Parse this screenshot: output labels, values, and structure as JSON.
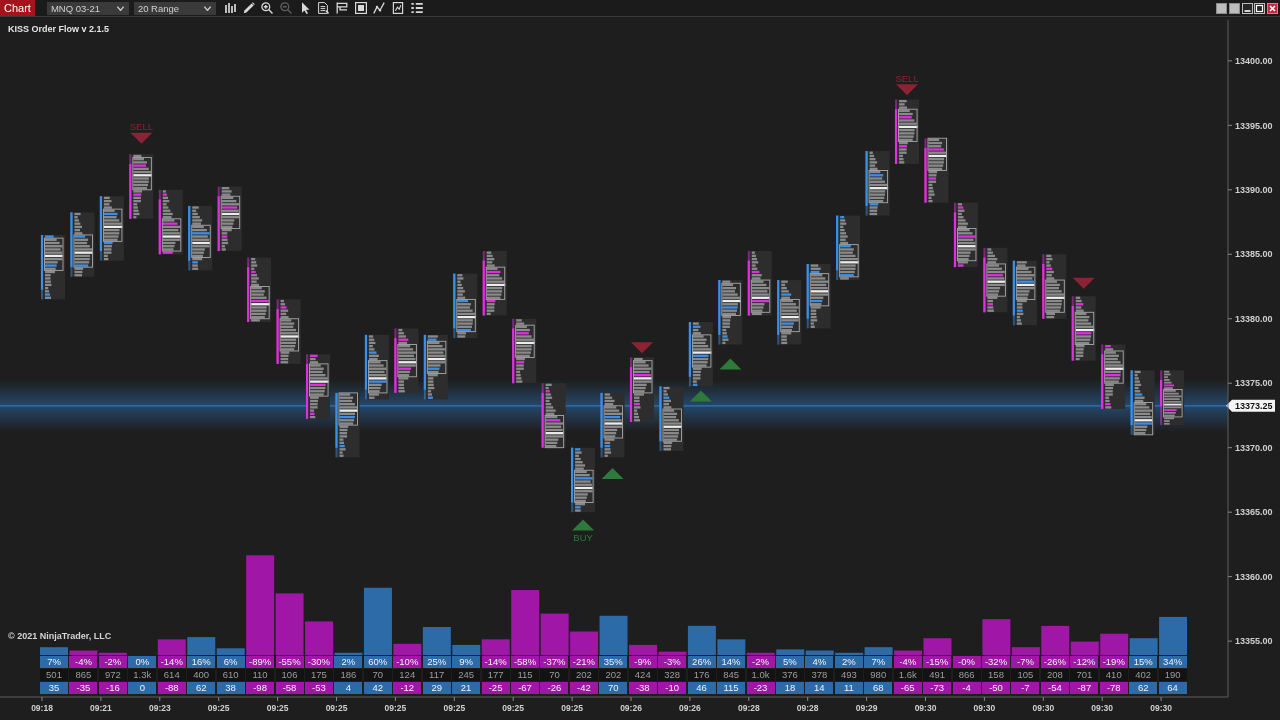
{
  "toolbar": {
    "tab": "Chart",
    "instrument": "MNQ 03-21",
    "interval": "20 Range",
    "tools": [
      {
        "kind": "bars",
        "disabled": false
      },
      {
        "kind": "pencil",
        "disabled": false
      },
      {
        "kind": "zoom_in",
        "disabled": false
      },
      {
        "kind": "zoom_out",
        "disabled": true
      },
      {
        "kind": "pointer",
        "disabled": false
      },
      {
        "kind": "properties",
        "disabled": false
      },
      {
        "kind": "template",
        "disabled": false
      },
      {
        "kind": "snapshot",
        "disabled": false
      },
      {
        "kind": "indicator",
        "disabled": false
      },
      {
        "kind": "strategy",
        "disabled": false
      },
      {
        "kind": "data_box",
        "disabled": false
      }
    ]
  },
  "window_buttons": [
    {
      "kind": "link"
    },
    {
      "kind": "link"
    },
    {
      "kind": "minimize"
    },
    {
      "kind": "maximize"
    },
    {
      "kind": "close"
    }
  ],
  "chart": {
    "indicator_title": "KISS Order Flow v 2.1.5",
    "chart_data": [
      {
        "type": "candlestick",
        "categories": [
          "09:18",
          null,
          "09:21",
          null,
          "09:23",
          null,
          "09:25",
          null,
          "09:25",
          null,
          "09:25",
          null,
          "09:25",
          null,
          "09:25",
          null,
          "09:25",
          null,
          "09:25",
          null,
          "09:26",
          null,
          "09:26",
          null,
          "09:28",
          null,
          "09:28",
          null,
          "09:29",
          null,
          "09:30",
          null,
          "09:30",
          null,
          "09:30",
          null,
          "09:30",
          null,
          "09:30"
        ],
        "ylim": [
          13350.9,
          13403.4
        ],
        "yticks": [
          {
            "value": 13400,
            "label": "13400.00"
          },
          {
            "value": 13395,
            "label": "13395.00"
          },
          {
            "value": 13390,
            "label": "13390.00"
          },
          {
            "value": 13385,
            "label": "13385.00"
          },
          {
            "value": 13380,
            "label": "13380.00"
          },
          {
            "value": 13375,
            "label": "13375.00"
          },
          {
            "value": 13370,
            "label": "13370.00"
          },
          {
            "value": 13365,
            "label": "13365.00"
          },
          {
            "value": 13360,
            "label": "13360.00"
          },
          {
            "value": 13355,
            "label": "13355.00"
          }
        ],
        "ref_lines": [
          {
            "axis": "y",
            "value": 13373.25,
            "label": "13373.25",
            "color": "#2f7fd0"
          }
        ],
        "series": [
          {
            "type": "candlestick",
            "colors": [
              "#3b8fe8",
              "#3b8fe8",
              "#3b8fe8",
              "#e02fe0",
              "#e02fe0",
              "#3b8fe8",
              "#e02fe0",
              "#e02fe0",
              "#e02fe0",
              "#e02fe0",
              "#3b8fe8",
              "#3b8fe8",
              "#e02fe0",
              "#3b8fe8",
              "#3b8fe8",
              "#e02fe0",
              "#e02fe0",
              "#e02fe0",
              "#3b8fe8",
              "#3b8fe8",
              "#e02fe0",
              "#3b8fe8",
              "#3b8fe8",
              "#3b8fe8",
              "#e02fe0",
              "#3b8fe8",
              "#3b8fe8",
              "#3b8fe8",
              "#3b8fe8",
              "#e02fe0",
              "#e02fe0",
              "#e02fe0",
              "#e02fe0",
              "#3b8fe8",
              "#e02fe0",
              "#e02fe0",
              "#e02fe0",
              "#3b8fe8",
              "#e02fe0"
            ],
            "ohlc": [
              [
                13382.25,
                13386.5,
                13381.5,
                13386.5
              ],
              [
                13384,
                13388.25,
                13383.25,
                13388.25
              ],
              [
                13385.25,
                13389.5,
                13384.5,
                13389.5
              ],
              [
                13392,
                13392.75,
                13387.75,
                13387.75
              ],
              [
                13389.25,
                13390,
                13385,
                13385
              ],
              [
                13384.5,
                13388.75,
                13383.75,
                13388.75
              ],
              [
                13389.5,
                13390.25,
                13385.25,
                13385.25
              ],
              [
                13384,
                13384.75,
                13379.75,
                13379.75
              ],
              [
                13380.75,
                13381.5,
                13376.5,
                13376.5
              ],
              [
                13376.5,
                13377.25,
                13372.25,
                13372.25
              ],
              [
                13370,
                13374.25,
                13369.25,
                13374.25
              ],
              [
                13374.5,
                13378.75,
                13373.75,
                13378.75
              ],
              [
                13378.5,
                13379.25,
                13374.25,
                13374.25
              ],
              [
                13374.5,
                13378.75,
                13373.75,
                13378.75
              ],
              [
                13379.25,
                13383.5,
                13378.5,
                13383.5
              ],
              [
                13384.5,
                13385.25,
                13380.25,
                13380.25
              ],
              [
                13379.25,
                13380,
                13375,
                13375
              ],
              [
                13374.25,
                13375,
                13370,
                13370
              ],
              [
                13365.75,
                13370,
                13365,
                13370
              ],
              [
                13370,
                13374.25,
                13369.25,
                13374.25
              ],
              [
                13376.25,
                13377,
                13372,
                13372
              ],
              [
                13370.5,
                13374.75,
                13369.75,
                13374.75
              ],
              [
                13375.5,
                13379.75,
                13374.75,
                13379.75
              ],
              [
                13378.75,
                13383,
                13378,
                13383
              ],
              [
                13384.5,
                13385.25,
                13380.25,
                13380.25
              ],
              [
                13378.75,
                13383,
                13378,
                13383
              ],
              [
                13380,
                13384.25,
                13379.25,
                13384.25
              ],
              [
                13383.75,
                13388,
                13383,
                13388
              ],
              [
                13388.75,
                13393,
                13388,
                13393
              ],
              [
                13396.25,
                13397,
                13392,
                13392
              ],
              [
                13393.25,
                13394,
                13389,
                13389
              ],
              [
                13388.25,
                13389,
                13384,
                13384
              ],
              [
                13384.75,
                13385.5,
                13380.5,
                13380.5
              ],
              [
                13380.25,
                13384.5,
                13379.5,
                13384.5
              ],
              [
                13384.25,
                13385,
                13380,
                13380
              ],
              [
                13381,
                13381.75,
                13376.75,
                13376.75
              ],
              [
                13377.25,
                13378,
                13373,
                13373
              ],
              [
                13371.75,
                13376,
                13371,
                13376
              ],
              [
                13375.25,
                13376,
                13371.75,
                13373.25
              ]
            ]
          },
          {
            "type": "scatter",
            "marker": "triangle-down",
            "color": "#8a2434",
            "values": [
              null,
              null,
              null,
              13394,
              null,
              null,
              null,
              null,
              null,
              null,
              null,
              null,
              null,
              null,
              null,
              null,
              null,
              null,
              null,
              null,
              13377.75,
              null,
              null,
              null,
              null,
              null,
              null,
              null,
              null,
              13397.75,
              null,
              null,
              null,
              null,
              null,
              13382.75,
              null,
              null,
              null
            ],
            "value_labels": [
              null,
              null,
              null,
              "SELL",
              null,
              null,
              null,
              null,
              null,
              null,
              null,
              null,
              null,
              null,
              null,
              null,
              null,
              null,
              null,
              null,
              null,
              null,
              null,
              null,
              null,
              null,
              null,
              null,
              null,
              "SELL",
              null,
              null,
              null,
              null,
              null,
              null,
              null,
              null,
              null
            ]
          },
          {
            "type": "scatter",
            "marker": "triangle-up",
            "color": "#2f7a3a",
            "values": [
              null,
              null,
              null,
              null,
              null,
              null,
              null,
              null,
              null,
              null,
              null,
              null,
              null,
              null,
              null,
              null,
              null,
              null,
              13364,
              13368,
              null,
              null,
              13374,
              13376.5,
              null,
              null,
              null,
              null,
              null,
              null,
              null,
              null,
              null,
              null,
              null,
              null,
              null,
              null,
              null
            ],
            "value_labels": [
              null,
              null,
              null,
              null,
              null,
              null,
              null,
              null,
              null,
              null,
              null,
              null,
              null,
              null,
              null,
              null,
              null,
              null,
              "BUY",
              null,
              null,
              null,
              null,
              null,
              null,
              null,
              null,
              null,
              null,
              null,
              null,
              null,
              null,
              null,
              null,
              null,
              null,
              null,
              null
            ]
          }
        ]
      }
    ],
    "stats": [
      {
        "delta_pct": "7%",
        "volume": "501",
        "delta": "35",
        "color": "#2d6aa8"
      },
      {
        "delta_pct": "-4%",
        "volume": "865",
        "delta": "-35",
        "color": "#a016a6"
      },
      {
        "delta_pct": "-2%",
        "volume": "972",
        "delta": "-16",
        "color": "#a016a6"
      },
      {
        "delta_pct": "0%",
        "volume": "1.3k",
        "delta": "0",
        "color": "#2d6aa8"
      },
      {
        "delta_pct": "-14%",
        "volume": "614",
        "delta": "-88",
        "color": "#a016a6"
      },
      {
        "delta_pct": "16%",
        "volume": "400",
        "delta": "62",
        "color": "#2d6aa8"
      },
      {
        "delta_pct": "6%",
        "volume": "610",
        "delta": "38",
        "color": "#2d6aa8"
      },
      {
        "delta_pct": "-89%",
        "volume": "110",
        "delta": "-98",
        "color": "#a016a6"
      },
      {
        "delta_pct": "-55%",
        "volume": "106",
        "delta": "-58",
        "color": "#a016a6"
      },
      {
        "delta_pct": "-30%",
        "volume": "175",
        "delta": "-53",
        "color": "#a016a6"
      },
      {
        "delta_pct": "2%",
        "volume": "186",
        "delta": "4",
        "color": "#2d6aa8"
      },
      {
        "delta_pct": "60%",
        "volume": "70",
        "delta": "42",
        "color": "#2d6aa8"
      },
      {
        "delta_pct": "-10%",
        "volume": "124",
        "delta": "-12",
        "color": "#a016a6"
      },
      {
        "delta_pct": "25%",
        "volume": "117",
        "delta": "29",
        "color": "#2d6aa8"
      },
      {
        "delta_pct": "9%",
        "volume": "245",
        "delta": "21",
        "color": "#2d6aa8"
      },
      {
        "delta_pct": "-14%",
        "volume": "177",
        "delta": "-25",
        "color": "#a016a6"
      },
      {
        "delta_pct": "-58%",
        "volume": "115",
        "delta": "-67",
        "color": "#a016a6"
      },
      {
        "delta_pct": "-37%",
        "volume": "70",
        "delta": "-26",
        "color": "#a016a6"
      },
      {
        "delta_pct": "-21%",
        "volume": "202",
        "delta": "-42",
        "color": "#a016a6"
      },
      {
        "delta_pct": "35%",
        "volume": "202",
        "delta": "70",
        "color": "#2d6aa8"
      },
      {
        "delta_pct": "-9%",
        "volume": "424",
        "delta": "-38",
        "color": "#a016a6"
      },
      {
        "delta_pct": "-3%",
        "volume": "328",
        "delta": "-10",
        "color": "#a016a6"
      },
      {
        "delta_pct": "26%",
        "volume": "176",
        "delta": "46",
        "color": "#2d6aa8"
      },
      {
        "delta_pct": "14%",
        "volume": "845",
        "delta": "115",
        "color": "#2d6aa8"
      },
      {
        "delta_pct": "-2%",
        "volume": "1.0k",
        "delta": "-23",
        "color": "#a016a6"
      },
      {
        "delta_pct": "5%",
        "volume": "376",
        "delta": "18",
        "color": "#2d6aa8"
      },
      {
        "delta_pct": "4%",
        "volume": "378",
        "delta": "14",
        "color": "#2d6aa8"
      },
      {
        "delta_pct": "2%",
        "volume": "493",
        "delta": "11",
        "color": "#2d6aa8"
      },
      {
        "delta_pct": "7%",
        "volume": "980",
        "delta": "68",
        "color": "#2d6aa8"
      },
      {
        "delta_pct": "-4%",
        "volume": "1.6k",
        "delta": "-65",
        "color": "#a016a6"
      },
      {
        "delta_pct": "-15%",
        "volume": "491",
        "delta": "-73",
        "color": "#a016a6"
      },
      {
        "delta_pct": "-0%",
        "volume": "866",
        "delta": "-4",
        "color": "#a016a6"
      },
      {
        "delta_pct": "-32%",
        "volume": "158",
        "delta": "-50",
        "color": "#a016a6"
      },
      {
        "delta_pct": "-7%",
        "volume": "105",
        "delta": "-7",
        "color": "#a016a6"
      },
      {
        "delta_pct": "-26%",
        "volume": "208",
        "delta": "-54",
        "color": "#a016a6"
      },
      {
        "delta_pct": "-12%",
        "volume": "701",
        "delta": "-87",
        "color": "#a016a6"
      },
      {
        "delta_pct": "-19%",
        "volume": "410",
        "delta": "-78",
        "color": "#a016a6"
      },
      {
        "delta_pct": "15%",
        "volume": "402",
        "delta": "62",
        "color": "#2d6aa8"
      },
      {
        "delta_pct": "34%",
        "volume": "190",
        "delta": "64",
        "color": "#2d6aa8"
      }
    ],
    "copyright": "© 2021 NinjaTrader, LLC"
  }
}
